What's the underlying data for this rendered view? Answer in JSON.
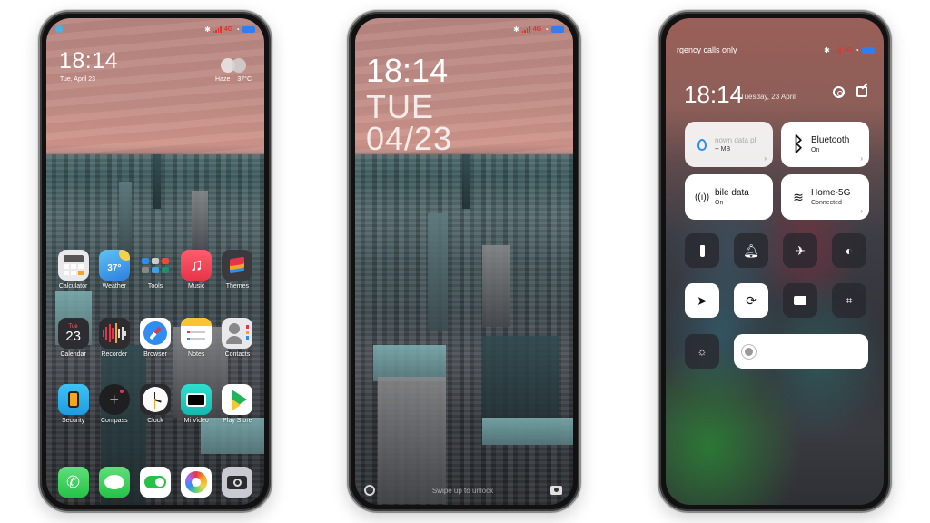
{
  "status": {
    "network": "4G",
    "colors": {
      "signal": "#e5322d",
      "battery": "#2f7ff2"
    }
  },
  "home": {
    "time": "18:14",
    "date": "Tue, April 23",
    "weather": {
      "condition": "Haze",
      "temperature": "37°C"
    },
    "apps": [
      [
        {
          "label": "Calculator",
          "icon": "calculator-icon"
        },
        {
          "label": "Weather",
          "icon": "weather-icon",
          "badge": "37°"
        },
        {
          "label": "Tools",
          "icon": "tools-folder-icon"
        },
        {
          "label": "Music",
          "icon": "music-icon"
        },
        {
          "label": "Themes",
          "icon": "themes-icon"
        }
      ],
      [
        {
          "label": "Calendar",
          "icon": "calendar-icon",
          "day_name": "Tue",
          "day_num": "23"
        },
        {
          "label": "Recorder",
          "icon": "recorder-icon"
        },
        {
          "label": "Browser",
          "icon": "browser-icon"
        },
        {
          "label": "Notes",
          "icon": "notes-icon"
        },
        {
          "label": "Contacts",
          "icon": "contacts-icon"
        }
      ],
      [
        {
          "label": "Security",
          "icon": "security-icon"
        },
        {
          "label": "Compass",
          "icon": "compass-icon"
        },
        {
          "label": "Clock",
          "icon": "clock-icon"
        },
        {
          "label": "Mi Video",
          "icon": "mi-video-icon"
        },
        {
          "label": "Play Store",
          "icon": "play-store-icon"
        }
      ]
    ],
    "dock": [
      {
        "icon": "phone-icon"
      },
      {
        "icon": "messages-icon"
      },
      {
        "icon": "toggle-settings-icon"
      },
      {
        "icon": "gallery-icon"
      },
      {
        "icon": "camera-icon"
      }
    ]
  },
  "lock": {
    "time": "18:14",
    "day": "TUE",
    "date": "04/23",
    "hint": "Swipe up to unlock"
  },
  "control_center": {
    "carrier_text": "rgency calls only",
    "time": "18:14",
    "date": "Tuesday, 23 April",
    "tiles": [
      {
        "title": "nown data pl",
        "subtitle": "-- MB",
        "icon": "data-usage-icon"
      },
      {
        "title": "Bluetooth",
        "subtitle": "On",
        "icon": "bluetooth-icon"
      },
      {
        "title": "bile data",
        "subtitle": "On",
        "icon": "mobile-data-icon"
      },
      {
        "title": "Home-5G",
        "subtitle": "Connected",
        "icon": "wifi-icon"
      }
    ],
    "toggles": [
      {
        "name": "flashlight",
        "active": false
      },
      {
        "name": "sound",
        "active": false
      },
      {
        "name": "airplane-mode",
        "active": false
      },
      {
        "name": "dark-mode",
        "active": false
      },
      {
        "name": "location",
        "active": true
      },
      {
        "name": "rotation-lock",
        "active": true
      },
      {
        "name": "screen-recorder",
        "active": false
      },
      {
        "name": "scanner",
        "active": false
      },
      {
        "name": "auto-brightness",
        "active": false
      }
    ],
    "brightness_percent": 100
  }
}
